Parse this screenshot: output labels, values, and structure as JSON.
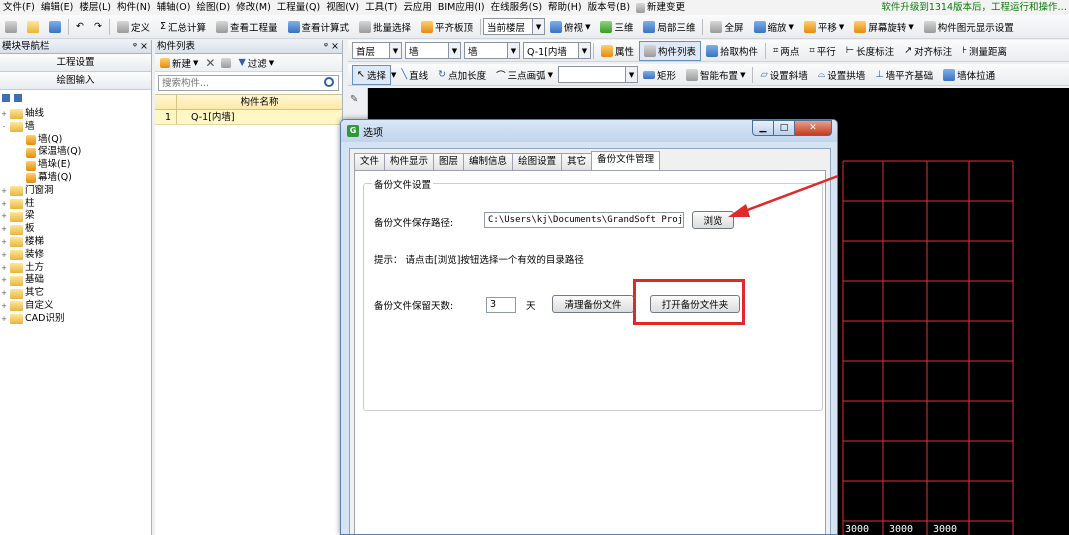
{
  "menubar": {
    "items": [
      "文件(F)",
      "编辑(E)",
      "楼层(L)",
      "构件(N)",
      "辅轴(O)",
      "绘图(D)",
      "修改(M)",
      "工程量(Q)",
      "视图(V)",
      "工具(T)",
      "云应用",
      "BIM应用(I)",
      "在线服务(S)",
      "帮助(H)",
      "版本号(B)"
    ],
    "new_change": "新建变更",
    "notice": "软件升级到1314版本后，工程运行和操作…"
  },
  "toolbar1": {
    "define": "定义",
    "summary": "汇总计算",
    "view_quantity": "查看工程量",
    "view_formula": "查看计算式",
    "batch_select": "批量选择",
    "align_top": "平齐板顶",
    "floor_select": "当前楼层",
    "top_view": "俯视",
    "three_d": "三维",
    "local_3d": "局部三维",
    "fullscreen": "全屏",
    "zoom": "缩放",
    "pan": "平移",
    "rotate": "屏幕旋转",
    "display_settings": "构件图元显示设置"
  },
  "nav": {
    "title": "模块导航栏",
    "btn_project_settings": "工程设置",
    "btn_drawing_input": "绘图输入",
    "tree": [
      {
        "label": "轴线",
        "level": 1,
        "exp": "+"
      },
      {
        "label": "墙",
        "level": 1,
        "exp": "-"
      },
      {
        "label": "墙(Q)",
        "level": 2,
        "exp": ""
      },
      {
        "label": "保温墙(Q)",
        "level": 2,
        "exp": ""
      },
      {
        "label": "墙垛(E)",
        "level": 2,
        "exp": ""
      },
      {
        "label": "幕墙(Q)",
        "level": 2,
        "exp": ""
      },
      {
        "label": "门窗洞",
        "level": 1,
        "exp": "+"
      },
      {
        "label": "柱",
        "level": 1,
        "exp": "+"
      },
      {
        "label": "梁",
        "level": 1,
        "exp": "+"
      },
      {
        "label": "板",
        "level": 1,
        "exp": "+"
      },
      {
        "label": "楼梯",
        "level": 1,
        "exp": "+"
      },
      {
        "label": "装修",
        "level": 1,
        "exp": "+"
      },
      {
        "label": "土方",
        "level": 1,
        "exp": "+"
      },
      {
        "label": "基础",
        "level": 1,
        "exp": "+"
      },
      {
        "label": "其它",
        "level": 1,
        "exp": "+"
      },
      {
        "label": "自定义",
        "level": 1,
        "exp": "+"
      },
      {
        "label": "CAD识别",
        "level": 1,
        "exp": "+"
      }
    ]
  },
  "complist": {
    "title": "构件列表",
    "new": "新建",
    "filter": "过滤",
    "search_placeholder": "搜索构件...",
    "col_name": "构件名称",
    "rows": [
      {
        "index": "1",
        "name": "Q-1[内墙]"
      }
    ]
  },
  "toolbar2": {
    "floor": "首层",
    "type1": "墙",
    "type2": "墙",
    "component": "Q-1[内墙",
    "property": "属性",
    "component_list": "构件列表",
    "pick": "拾取构件",
    "two_points": "两点",
    "parallel": "平行",
    "length_mark": "长度标注",
    "align_mark": "对齐标注",
    "measure": "测量距离"
  },
  "toolbar3": {
    "select": "选择",
    "line": "直线",
    "point_length": "点加长度",
    "arc": "三点画弧",
    "rect": "矩形",
    "smart_layout": "智能布置",
    "set_slope": "设置斜墙",
    "set_arch": "设置拱墙",
    "align_base": "墙平齐基础",
    "wall_stretch": "墙体拉通"
  },
  "dialog": {
    "title": "选项",
    "tabs": [
      "文件",
      "构件显示",
      "图层",
      "编制信息",
      "绘图设置",
      "其它",
      "备份文件管理"
    ],
    "active_tab": 6,
    "group_title": "备份文件设置",
    "path_label": "备份文件保存路径:",
    "path_value": "C:\\Users\\kj\\Documents\\GrandSoft Projects\\",
    "browse": "浏览",
    "hint": "提示：  请点击[浏览]按钮选择一个有效的目录路径",
    "days_label": "备份文件保留天数:",
    "days_value": "3",
    "days_unit": "天",
    "clean_backup": "清理备份文件",
    "open_backup_folder": "打开备份文件夹"
  },
  "cad": {
    "dims": [
      "3000",
      "3000",
      "3000"
    ]
  },
  "colors": {
    "cad_bg": "#000000",
    "grid_line": "#e0303a",
    "annotation_red": "#e02a2a",
    "notice_green": "#0a7a0a"
  }
}
